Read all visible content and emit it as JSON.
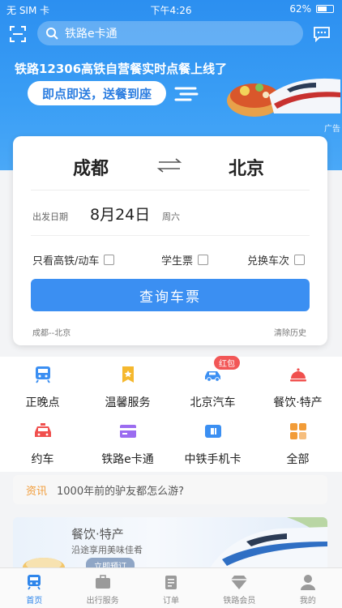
{
  "status": {
    "carrier": "无 SIM 卡",
    "time": "下午4:26",
    "battery": "62%",
    "battery_level": 0.62
  },
  "search": {
    "text": "铁路e卡通"
  },
  "banner": {
    "title": "铁路12306高铁自营餐实时点餐上线了",
    "pill": "即点即送，送餐到座",
    "ad": "广告"
  },
  "ticket": {
    "from": "成都",
    "to": "北京",
    "date_label": "出发日期",
    "date": "8月24日",
    "weekday": "周六",
    "options": [
      "只看高铁/动车",
      "学生票",
      "兑换车次"
    ],
    "query": "查询车票",
    "history": "成都--北京",
    "clear": "清除历史"
  },
  "services": [
    {
      "label": "正晚点",
      "icon": "train-icon"
    },
    {
      "label": "温馨服务",
      "icon": "service-icon"
    },
    {
      "label": "北京汽车",
      "icon": "car-icon",
      "badge": "红包"
    },
    {
      "label": "餐饮·特产",
      "icon": "food-icon"
    },
    {
      "label": "约车",
      "icon": "taxi-icon"
    },
    {
      "label": "铁路e卡通",
      "icon": "card-icon"
    },
    {
      "label": "中铁手机卡",
      "icon": "sim-icon"
    },
    {
      "label": "全部",
      "icon": "grid-icon"
    }
  ],
  "news": {
    "tag": "资讯",
    "text": "1000年前的驴友都怎么游?"
  },
  "promo": {
    "title": "餐饮·特产",
    "subtitle": "沿途享用美味佳肴",
    "button": "立即预订"
  },
  "tabs": [
    "首页",
    "出行服务",
    "订单",
    "铁路会员",
    "我的"
  ],
  "colors": {
    "primary": "#3b8ff2",
    "badge": "#f25757",
    "news_tag": "#f29c38"
  }
}
